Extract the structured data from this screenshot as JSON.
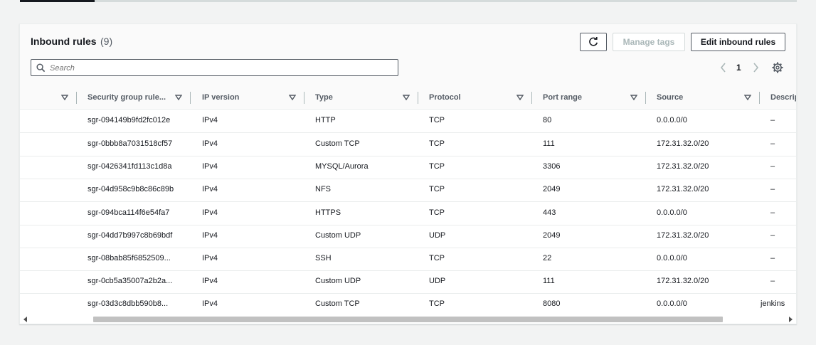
{
  "header": {
    "title": "Inbound rules",
    "count": "(9)",
    "refresh_icon": "refresh-icon",
    "manage_tags_label": "Manage tags",
    "edit_label": "Edit inbound rules"
  },
  "search": {
    "placeholder": "Search"
  },
  "pagination": {
    "current": "1"
  },
  "columns": [
    "Security group rule...",
    "IP version",
    "Type",
    "Protocol",
    "Port range",
    "Source",
    "Descrip"
  ],
  "rows": [
    {
      "id": "sgr-094149b9fd2fc012e",
      "ip": "IPv4",
      "type": "HTTP",
      "protocol": "TCP",
      "port": "80",
      "source": "0.0.0.0/0",
      "desc": "–"
    },
    {
      "id": "sgr-0bbb8a7031518cf57",
      "ip": "IPv4",
      "type": "Custom TCP",
      "protocol": "TCP",
      "port": "111",
      "source": "172.31.32.0/20",
      "desc": "–"
    },
    {
      "id": "sgr-0426341fd113c1d8a",
      "ip": "IPv4",
      "type": "MYSQL/Aurora",
      "protocol": "TCP",
      "port": "3306",
      "source": "172.31.32.0/20",
      "desc": "–"
    },
    {
      "id": "sgr-04d958c9b8c86c89b",
      "ip": "IPv4",
      "type": "NFS",
      "protocol": "TCP",
      "port": "2049",
      "source": "172.31.32.0/20",
      "desc": "–"
    },
    {
      "id": "sgr-094bca114f6e54fa7",
      "ip": "IPv4",
      "type": "HTTPS",
      "protocol": "TCP",
      "port": "443",
      "source": "0.0.0.0/0",
      "desc": "–"
    },
    {
      "id": "sgr-04dd7b997c8b69bdf",
      "ip": "IPv4",
      "type": "Custom UDP",
      "protocol": "UDP",
      "port": "2049",
      "source": "172.31.32.0/20",
      "desc": "–"
    },
    {
      "id": "sgr-08bab85f6852509...",
      "ip": "IPv4",
      "type": "SSH",
      "protocol": "TCP",
      "port": "22",
      "source": "0.0.0.0/0",
      "desc": "–"
    },
    {
      "id": "sgr-0cb5a35007a2b2a...",
      "ip": "IPv4",
      "type": "Custom UDP",
      "protocol": "UDP",
      "port": "111",
      "source": "172.31.32.0/20",
      "desc": "–"
    },
    {
      "id": "sgr-03d3c8dbb590b8...",
      "ip": "IPv4",
      "type": "Custom TCP",
      "protocol": "TCP",
      "port": "8080",
      "source": "0.0.0.0/0",
      "desc": "jenkins"
    }
  ]
}
